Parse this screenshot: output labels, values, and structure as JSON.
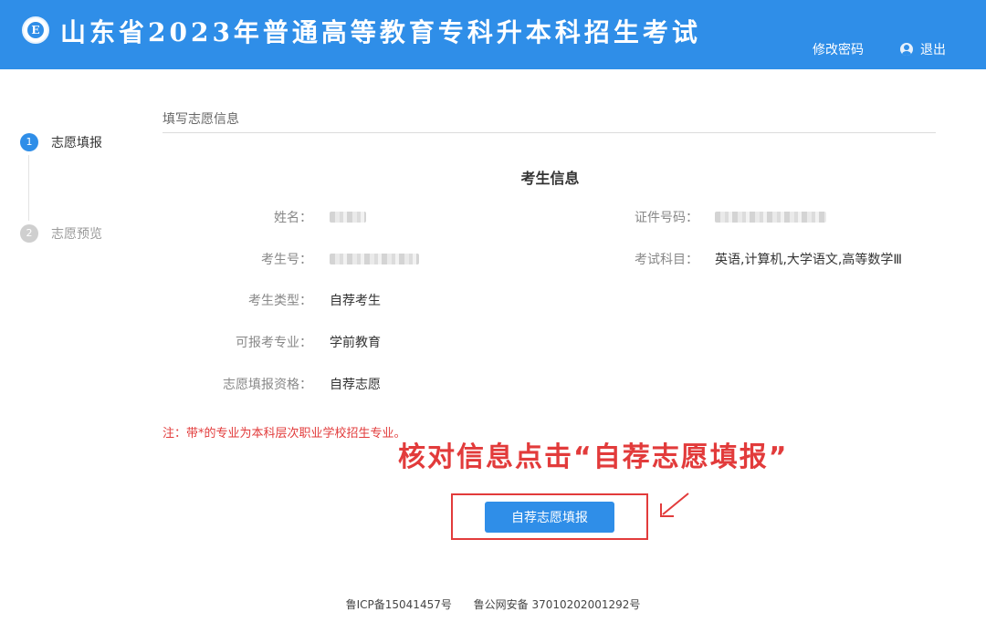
{
  "header": {
    "logo_letter": "E",
    "title": "山东省2023年普通高等教育专科升本科招生考试",
    "change_password": "修改密码",
    "logout": "退出"
  },
  "steps": [
    {
      "num": "1",
      "label": "志愿填报"
    },
    {
      "num": "2",
      "label": "志愿预览"
    }
  ],
  "section": {
    "title": "填写志愿信息",
    "panel_title": "考生信息"
  },
  "fields": {
    "name_label": "姓名：",
    "id_label": "证件号码：",
    "exam_no_label": "考生号：",
    "subjects_label": "考试科目：",
    "subjects_value": "英语,计算机,大学语文,高等数学Ⅲ",
    "type_label": "考生类型：",
    "type_value": "自荐考生",
    "major_label": "可报考专业：",
    "major_value": "学前教育",
    "qual_label": "志愿填报资格：",
    "qual_value": "自荐志愿"
  },
  "note": "注：带*的专业为本科层次职业学校招生专业。",
  "annotation": "核对信息点击“自荐志愿填报”",
  "submit_label": "自荐志愿填报",
  "footer": {
    "icp": "鲁ICP备15041457号",
    "police": "鲁公网安备 37010202001292号"
  },
  "colors": {
    "primary": "#2f8ee8",
    "annotation_red": "#e23b3b"
  }
}
